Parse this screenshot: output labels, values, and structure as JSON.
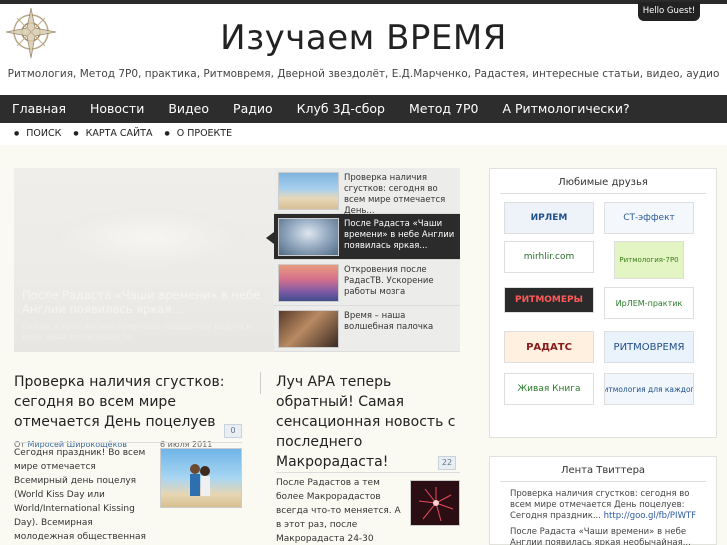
{
  "header": {
    "title": "Изучаем ВРЕМЯ",
    "subtitle": "Ритмология, Метод 7Р0, практика, Ритмовремя, Дверной звездолёт, Е.Д.Марченко, Радастея, интересные статьи, видео, аудио",
    "greeting": "Hello Guest!"
  },
  "nav": {
    "items": [
      "Главная",
      "Новости",
      "Видео",
      "Радио",
      "Клуб 3Д-сбор",
      "Метод 7Р0",
      "А Ритмологически?"
    ]
  },
  "subnav": {
    "items": [
      "ПОИСК",
      "КАРТА САЙТА",
      "О ПРОЕКТЕ"
    ]
  },
  "slider": {
    "caption_title": "После Радаста «Чаши времени» в небе Англии появилась яркая...",
    "caption_text": "Сейчас в небе Англии появилась загадочная радуга в виде чаши после радаста",
    "thumbs": [
      "Проверка наличия сгустков: сегодня во всем мире отмечается День...",
      "После Радаста «Чаши времени» в небе Англии появилась яркая...",
      "Откровения после РадасТВ. Ускорение работы мозга",
      "Время – наша волшебная палочка"
    ]
  },
  "posts": [
    {
      "title": "Проверка наличия сгустков: сегодня во всем мире отмечается День поцелуев",
      "meta_prefix": "От",
      "author": "Миросей Широкощёков",
      "date": "6 июля 2011",
      "comments": "0",
      "body": "Сегодня праздник! Во всем мире отмечается Всемирный день поцелуя (World Kiss Day или World/International Kissing Day). Всемирная молодежная общественная организация «Засилье красивых и мудрых»..."
    },
    {
      "title": "Луч АРА теперь обратный! Самая сенсационная новость с последнего Макрорадаста!",
      "comments": "22",
      "body": "После Радастов а тем более Макрорадастов всегда что-то меняется. А в этот раз, после Макрорадаста 24-30 апреля 2011, такое"
    }
  ],
  "sidebar": {
    "friends_title": "Любимые друзья",
    "friends": [
      "ИРЛЕМ",
      "СТ-эффект",
      "mirhlir.com",
      "Ритмология-7Р0",
      "РИТМОМЕРЫ",
      "ИрЛЕМ-практик",
      "РАДАТС",
      "РИТМОВРЕМЯ",
      "Живая Книга",
      "Ритмология для каждого"
    ],
    "twitter_title": "Лента Твиттера",
    "tweets": [
      {
        "text": "Проверка наличия сгустков: сегодня во всем мире отмечается День поцелуев: Сегодня праздник...",
        "link": "http://goo.gl/fb/PIWTF"
      },
      {
        "text": "После Радаста «Чаши времени» в небе Англии появилась яркая необычайная...",
        "link": ""
      }
    ]
  },
  "colors": {
    "nav_bg": "#2d2d2d",
    "content_bg": "#fafaf3",
    "accent_link": "#3a6a9a"
  },
  "icons": [
    "logo-emblem",
    "bullet-dot"
  ]
}
